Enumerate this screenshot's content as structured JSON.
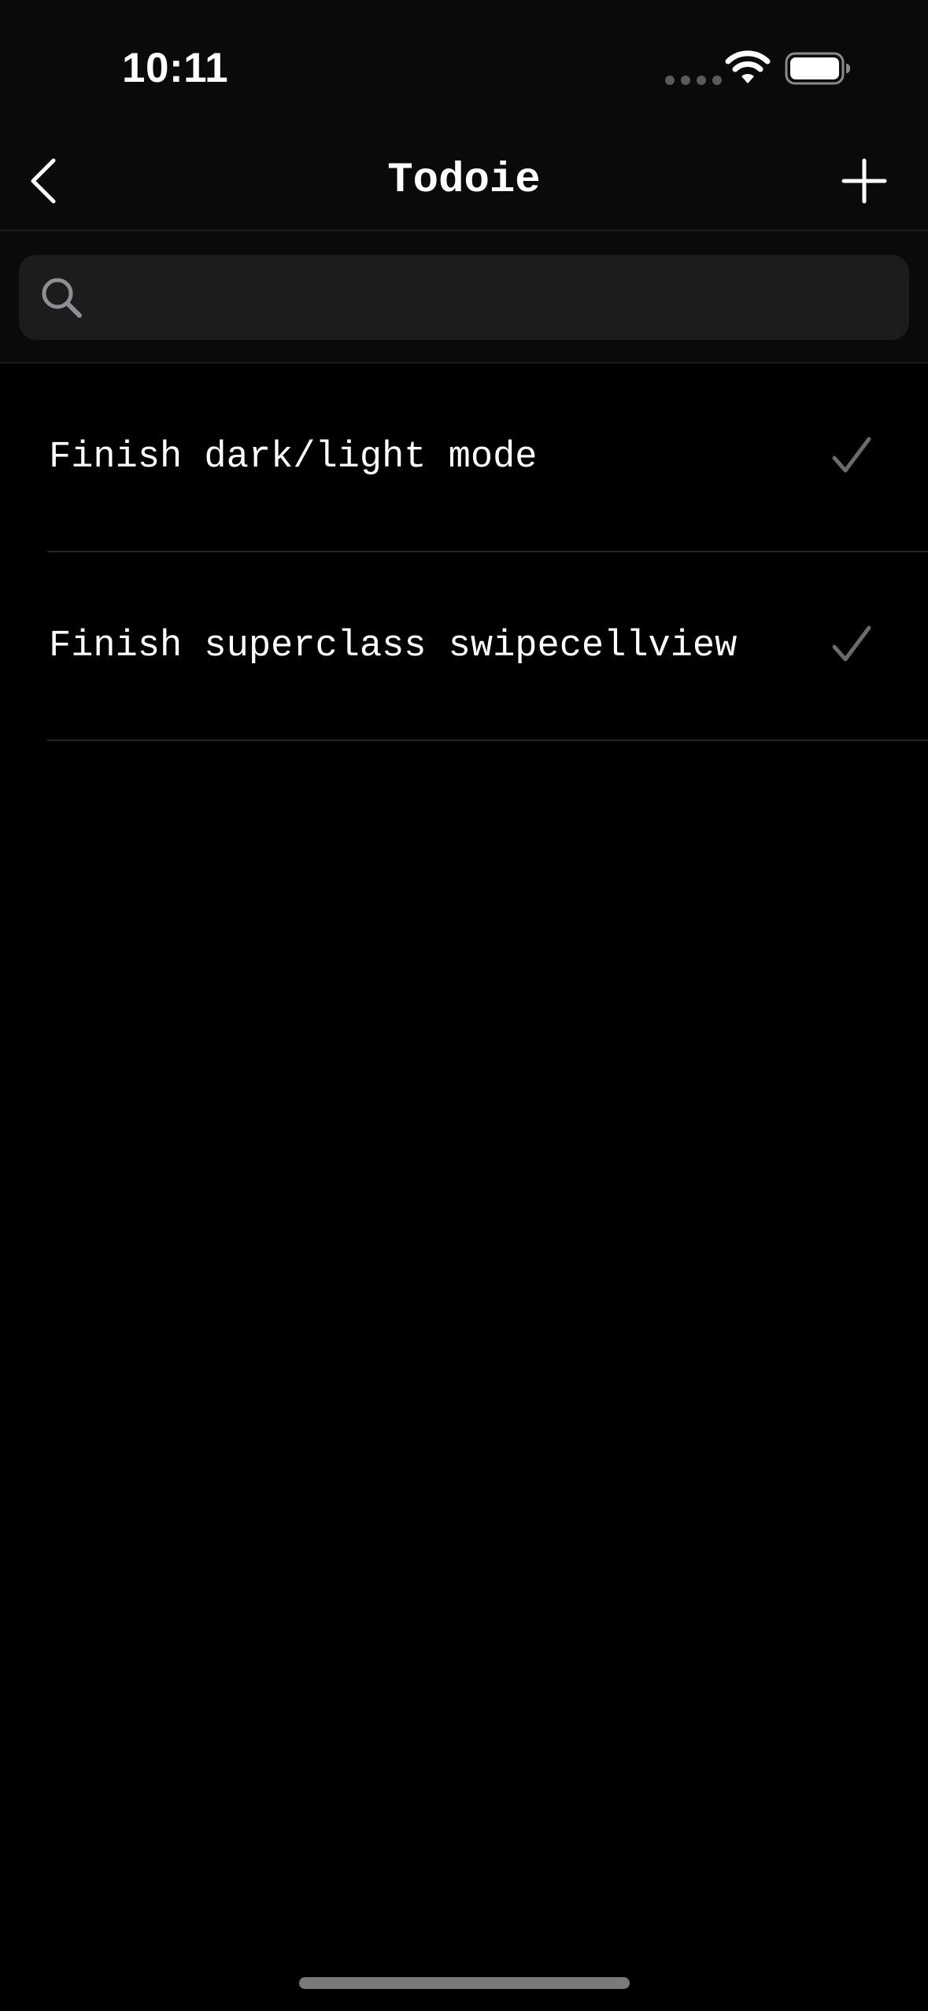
{
  "status_bar": {
    "time": "10:11"
  },
  "nav": {
    "title": "Todoie"
  },
  "search": {
    "value": "",
    "placeholder": ""
  },
  "todos": [
    {
      "title": "Finish dark/light mode",
      "done": true
    },
    {
      "title": "Finish superclass swipecellview",
      "done": true
    }
  ],
  "colors": {
    "background": "#000000",
    "bar": "#0a0a0a",
    "search_field": "#1c1c1e",
    "checkmark": "#6b6b6b",
    "separator": "#262626"
  }
}
